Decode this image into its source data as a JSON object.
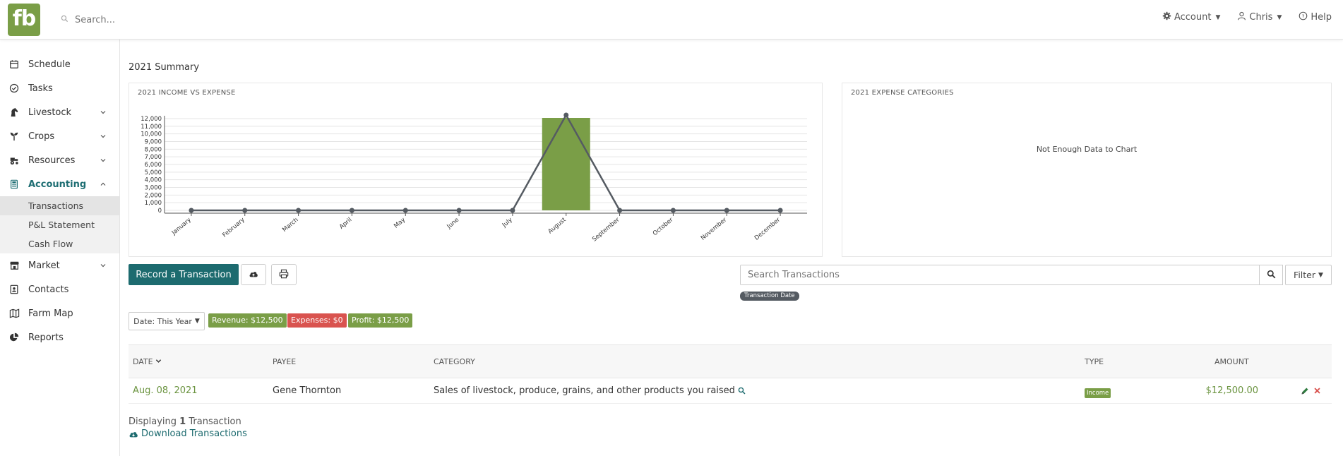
{
  "header": {
    "logo_text": "fb",
    "search_placeholder": "Search...",
    "account_label": "Account",
    "user_label": "Chris",
    "help_label": "Help"
  },
  "sidebar": {
    "items": [
      {
        "label": "Schedule"
      },
      {
        "label": "Tasks"
      },
      {
        "label": "Livestock"
      },
      {
        "label": "Crops"
      },
      {
        "label": "Resources"
      },
      {
        "label": "Accounting"
      },
      {
        "label": "Market"
      },
      {
        "label": "Contacts"
      },
      {
        "label": "Farm Map"
      },
      {
        "label": "Reports"
      }
    ],
    "accounting_sub": [
      {
        "label": "Transactions"
      },
      {
        "label": "P&L Statement"
      },
      {
        "label": "Cash Flow"
      }
    ]
  },
  "main": {
    "summary_title": "2021 Summary",
    "income_card_title": "2021 INCOME VS EXPENSE",
    "expense_card_title": "2021 EXPENSE CATEGORIES",
    "no_data_text": "Not Enough Data to Chart",
    "record_button": "Record a Transaction",
    "search_placeholder": "Search Transactions",
    "filter_label": "Filter",
    "tag_label": "Transaction Date",
    "date_filter": "Date: This Year",
    "revenue_badge": "Revenue: $12,500",
    "expenses_badge": "Expenses: $0",
    "profit_badge": "Profit: $12,500",
    "table": {
      "headers": {
        "date": "DATE",
        "payee": "PAYEE",
        "category": "CATEGORY",
        "type": "TYPE",
        "amount": "AMOUNT"
      },
      "rows": [
        {
          "date": "Aug. 08, 2021",
          "payee": "Gene Thornton",
          "category": "Sales of livestock, produce, grains, and other products you raised",
          "type": "Income",
          "amount": "$12,500.00"
        }
      ]
    },
    "displaying_prefix": "Displaying",
    "displaying_count": "1",
    "displaying_suffix": "Transaction",
    "download_label": "Download Transactions"
  },
  "colors": {
    "brand_green": "#7a9e47",
    "teal": "#1d6b6f",
    "red": "#d9534f",
    "line": "#555b62"
  },
  "chart_data": {
    "type": "bar",
    "title": "2021 INCOME VS EXPENSE",
    "categories": [
      "January",
      "February",
      "March",
      "April",
      "May",
      "June",
      "July",
      "August",
      "September",
      "October",
      "November",
      "December"
    ],
    "series": [
      {
        "type": "bar",
        "values": [
          0,
          0,
          0,
          0,
          0,
          0,
          0,
          12500,
          0,
          0,
          0,
          0
        ]
      },
      {
        "type": "line",
        "values": [
          0,
          0,
          0,
          0,
          0,
          0,
          0,
          12500,
          0,
          0,
          0,
          0
        ]
      }
    ],
    "yticks": [
      "0",
      "1,000",
      "2,000",
      "3,000",
      "4,000",
      "5,000",
      "6,000",
      "7,000",
      "8,000",
      "9,000",
      "10,000",
      "11,000",
      "12,000"
    ],
    "ylim": [
      0,
      12500
    ]
  }
}
